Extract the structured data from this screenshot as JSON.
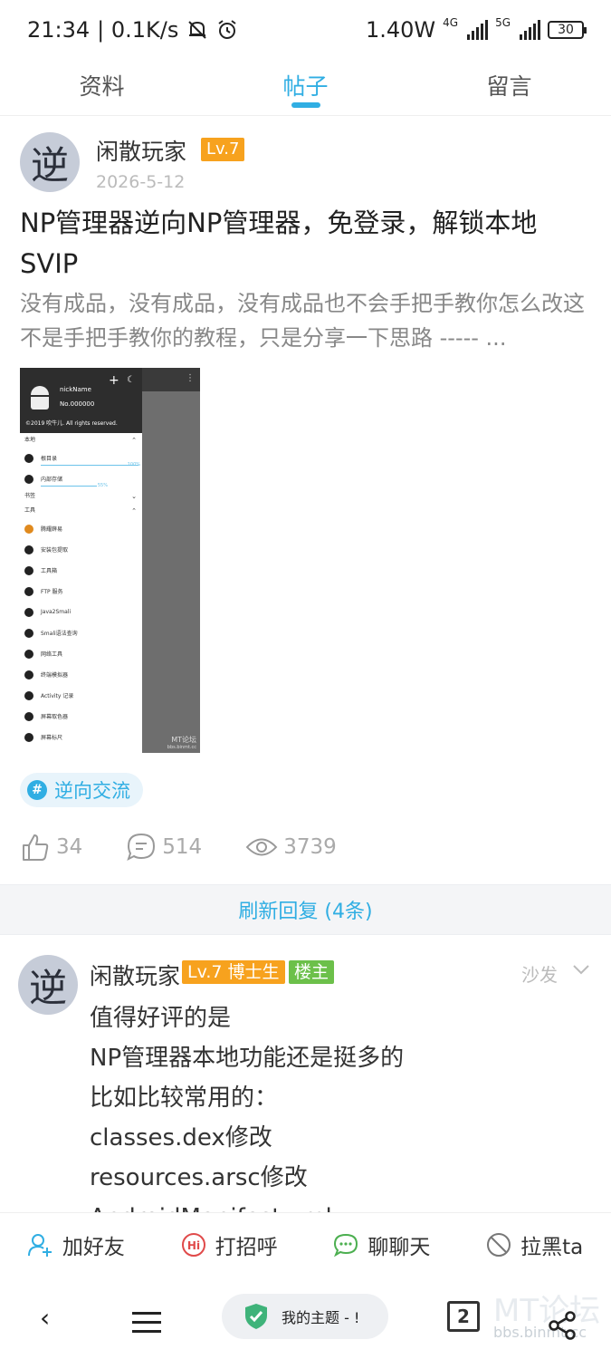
{
  "status_bar": {
    "time": "21:34",
    "speed": "| 0.1K/s",
    "power": "1.40W",
    "net1": "4G",
    "net2": "5G",
    "battery": "30"
  },
  "tabs": [
    {
      "label": "资料",
      "active": false
    },
    {
      "label": "帖子",
      "active": true
    },
    {
      "label": "留言",
      "active": false
    }
  ],
  "post": {
    "author": "闲散玩家",
    "avatar_char": "逆",
    "level": "Lv.7",
    "date": "2026-5-12",
    "title": "NP管理器逆向NP管理器，免登录，解锁本地SVIP",
    "excerpt": "没有成品，没有成品，没有成品也不会手把手教你怎么改这不是手把手教你的教程，只是分享一下思路 ----- ...",
    "image": {
      "nickname": "nickName",
      "number": "No.000000",
      "copyright": "©2019 吹牛儿. All rights reserved.",
      "sec_local": "本地",
      "sec_bookmark": "书签",
      "sec_tools": "工具",
      "storage": [
        {
          "label": "根目录",
          "percent": "100%"
        },
        {
          "label": "内部存储",
          "percent": "55%"
        }
      ],
      "tools": [
        "腾耀薛易",
        "安装包提取",
        "工具箱",
        "FTP 服务",
        "Java2Smali",
        "Smali语法查询",
        "网络工具",
        "终端模拟器",
        "Activity 记录",
        "屏幕取色器",
        "屏幕标尺"
      ],
      "watermark": "MT论坛",
      "watermark_url": "bbs.binmt.cc"
    },
    "tag": "逆向交流",
    "likes": "34",
    "comments": "514",
    "views": "3739"
  },
  "refresh_label": "刷新回复 (4条)",
  "reply": {
    "author": "闲散玩家",
    "avatar_char": "逆",
    "level": "Lv.7 博士生",
    "owner_badge": "楼主",
    "floor": "沙发",
    "lines": [
      "值得好评的是",
      "NP管理器本地功能还是挺多的",
      "比如比较常用的：",
      "classes.dex修改",
      "resources.arsc修改",
      "AndroidManifest.xml"
    ]
  },
  "actions": [
    {
      "label": "加好友",
      "icon": "add-friend-icon"
    },
    {
      "label": "打招呼",
      "icon": "hi-icon"
    },
    {
      "label": "聊聊天",
      "icon": "chat-icon"
    },
    {
      "label": "拉黑ta",
      "icon": "block-icon"
    }
  ],
  "nav": {
    "pill_label": "我的主题 - !",
    "count": "2",
    "watermark": "MT论坛",
    "watermark_url": "bbs.binmt.cc"
  },
  "colors": {
    "accent": "#30aee3",
    "level": "#f7a21e",
    "owner": "#6cc04a"
  }
}
